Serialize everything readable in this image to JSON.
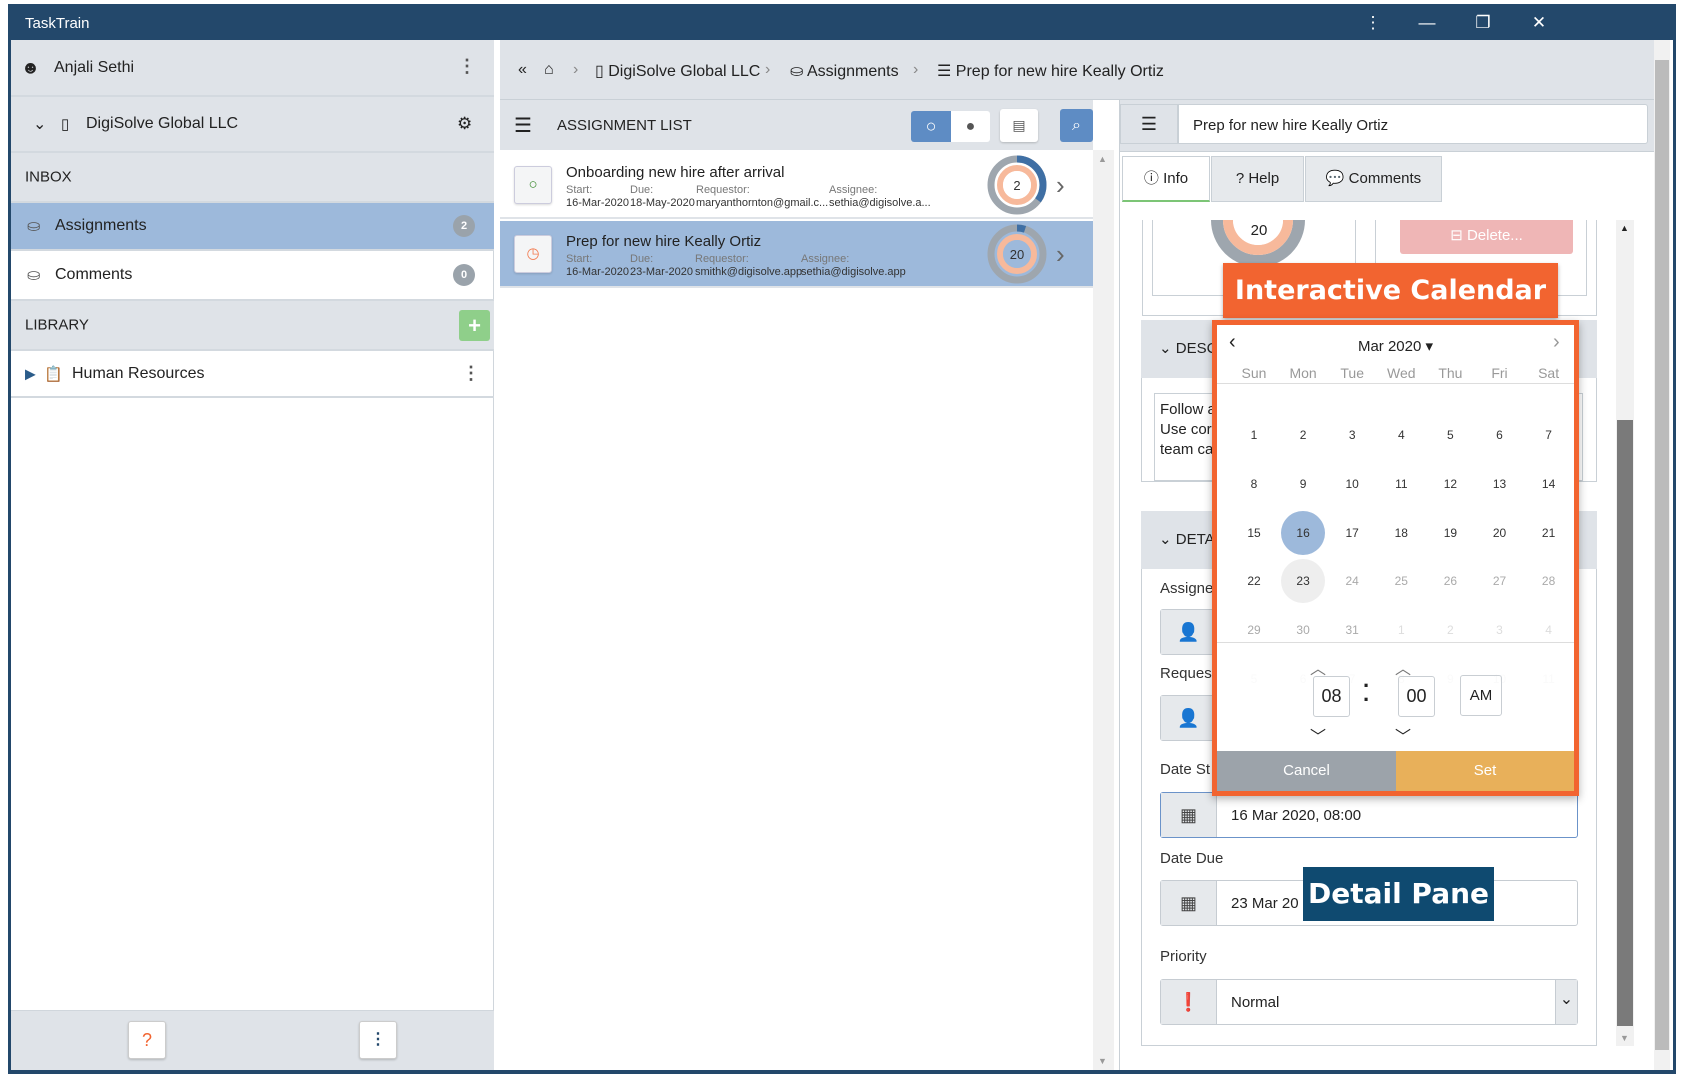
{
  "app": {
    "title": "TaskTrain",
    "window_buttons": [
      "⋮",
      "—",
      "❐",
      "✕"
    ]
  },
  "sidebar": {
    "user": "Anjali Sethi",
    "org": "DigiSolve Global LLC",
    "inbox_label": "INBOX",
    "inbox_items": [
      {
        "label": "Assignments",
        "count": "2"
      },
      {
        "label": "Comments",
        "count": "0"
      }
    ],
    "library_label": "LIBRARY",
    "library_items": [
      {
        "label": "Human Resources"
      }
    ]
  },
  "breadcrumb": {
    "items": [
      "DigiSolve Global LLC",
      "Assignments",
      "Prep for new hire Keally Ortiz"
    ]
  },
  "assignment_list": {
    "title": "ASSIGNMENT LIST",
    "columns": {
      "start": "Start:",
      "due": "Due:",
      "requestor": "Requestor:",
      "assignee": "Assignee:"
    },
    "rows": [
      {
        "title": "Onboarding new hire after arrival",
        "start": "16-Mar-2020",
        "due": "18-May-2020",
        "requestor": "maryanthornton@gmail.c...",
        "assignee": "sethia@digisolve.a...",
        "count": "2",
        "progress": 0.35,
        "status": "open"
      },
      {
        "title": "Prep for new hire Keally Ortiz",
        "start": "16-Mar-2020",
        "due": "23-Mar-2020",
        "requestor": "smithk@digisolve.app",
        "assignee": "sethia@digisolve.app",
        "count": "20",
        "progress": 0.05,
        "status": "scheduled"
      }
    ]
  },
  "detail": {
    "title": "Prep for new hire Keally Ortiz",
    "tabs": [
      "Info",
      "Help",
      "Comments"
    ],
    "progress_count": "20",
    "delete_label": "Delete...",
    "desc_header": "DESC",
    "desc_text": [
      "Follow a",
      "Use cor",
      "team ca"
    ],
    "details_header": "DETA",
    "labels": {
      "assignee": "Assigne",
      "requestor": "Reques",
      "date_start": "Date St",
      "date_due": "Date Due",
      "priority": "Priority"
    },
    "date_start": "16 Mar 2020, 08:00",
    "date_due": "23 Mar 20",
    "priority": "Normal"
  },
  "calendar": {
    "month_label": "Mar 2020",
    "weekdays": [
      "Sun",
      "Mon",
      "Tue",
      "Wed",
      "Thu",
      "Fri",
      "Sat"
    ],
    "weeks": [
      [
        "1",
        "2",
        "3",
        "4",
        "5",
        "6",
        "7"
      ],
      [
        "8",
        "9",
        "10",
        "11",
        "12",
        "13",
        "14"
      ],
      [
        "15",
        "16",
        "17",
        "18",
        "19",
        "20",
        "21"
      ],
      [
        "22",
        "23",
        "24",
        "25",
        "26",
        "27",
        "28"
      ],
      [
        "29",
        "30",
        "31",
        "1",
        "2",
        "3",
        "4"
      ],
      [
        "5",
        "6",
        "7",
        "8",
        "9",
        "10",
        "11"
      ]
    ],
    "selected": "16",
    "due": "23",
    "hour": "08",
    "minute": "00",
    "ampm": "AM",
    "cancel_label": "Cancel",
    "set_label": "Set"
  },
  "annotations": {
    "calendar": "Interactive Calendar",
    "detail": "Detail Pane"
  },
  "colors": {
    "titlebar": "#23486b",
    "selected": "#9db9db",
    "accent_orange": "#f26430",
    "annotation_blue": "#0f4a70",
    "set": "#e8b05a",
    "cancel": "#9ca3aa"
  }
}
